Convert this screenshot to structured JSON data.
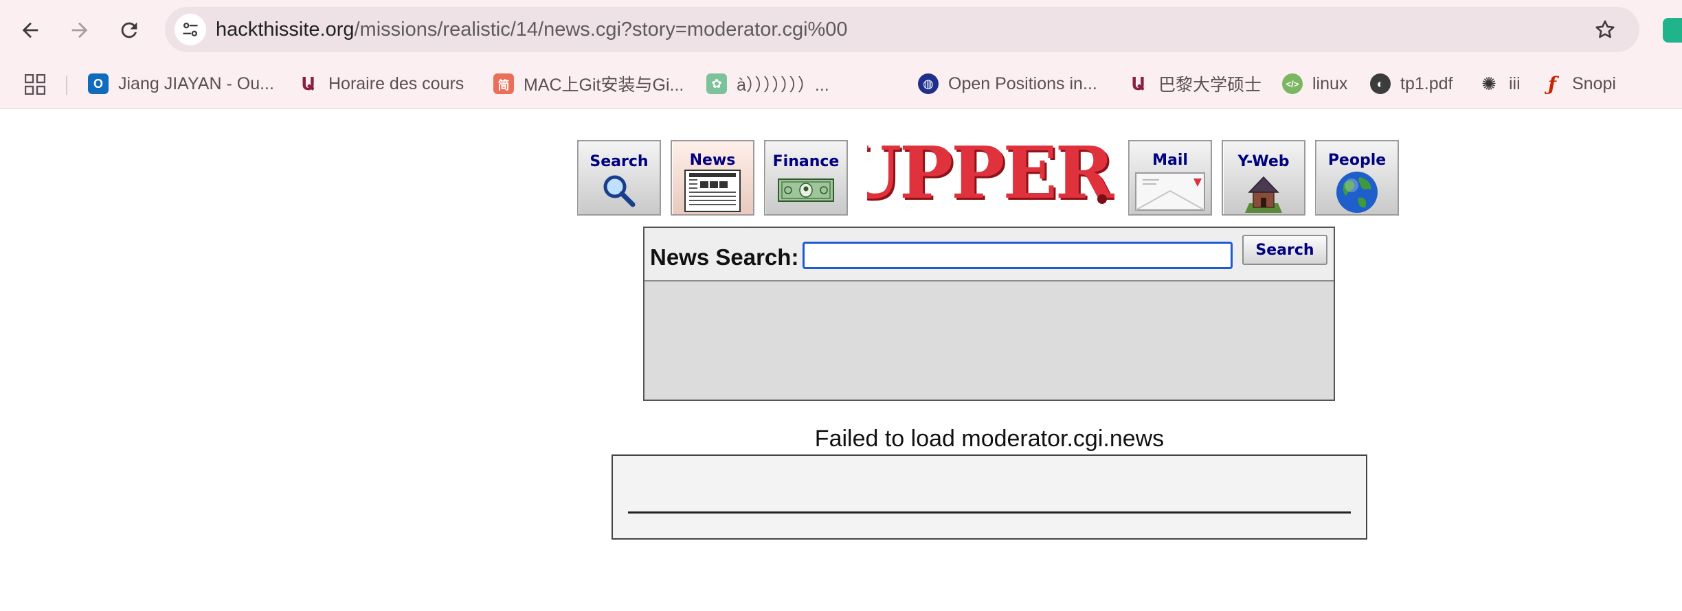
{
  "browser": {
    "url_host": "hackthissite.org",
    "url_path": "/missions/realistic/14/news.cgi?story=moderator.cgi%00",
    "icons": [
      "back-arrow-icon",
      "forward-arrow-icon",
      "reload-icon",
      "site-info-icon",
      "bookmark-star-icon",
      "apps-grid-icon"
    ]
  },
  "bookmarks": [
    {
      "label": "Jiang JIAYAN - Ou...",
      "icon": "outlook-icon",
      "color": "#0f6cbd"
    },
    {
      "label": "Horaire des cours",
      "icon": "university-icon",
      "color": "#8b1e3f"
    },
    {
      "label": "MAC上Git安装与Gi...",
      "icon": "jianshu-icon",
      "color": "#ea6f5a"
    },
    {
      "label": "à）））））））...",
      "icon": "paw-icon",
      "color": "#7cc29a"
    },
    {
      "label": "Open Positions in...",
      "icon": "globe-icon",
      "color": "#1f2f8a"
    },
    {
      "label": "巴黎大学硕士",
      "icon": "university-icon",
      "color": "#8b1e3f"
    },
    {
      "label": "linux",
      "icon": "code-icon",
      "color": "#7bb661"
    },
    {
      "label": "tp1.pdf",
      "icon": "world-icon",
      "color": "#3c3c3c"
    },
    {
      "label": "iii",
      "icon": "openai-icon",
      "color": "#333333"
    },
    {
      "label": "Snopi",
      "icon": "flash-icon",
      "color": "#cc2200"
    }
  ],
  "site": {
    "logo_text": "YUPPERS!",
    "nav": [
      {
        "label": "Search",
        "icon": "magnifier-icon"
      },
      {
        "label": "News",
        "icon": "newspaper-icon"
      },
      {
        "label": "Finance",
        "icon": "dollar-bill-icon"
      },
      {
        "label": "Mail",
        "icon": "envelope-icon"
      },
      {
        "label": "Y-Web",
        "icon": "house-icon"
      },
      {
        "label": "People",
        "icon": "earth-globe-icon"
      }
    ]
  },
  "news_search": {
    "label": "News Search:",
    "value": "",
    "button_label": "Search"
  },
  "message": "Failed to load moderator.cgi.news"
}
